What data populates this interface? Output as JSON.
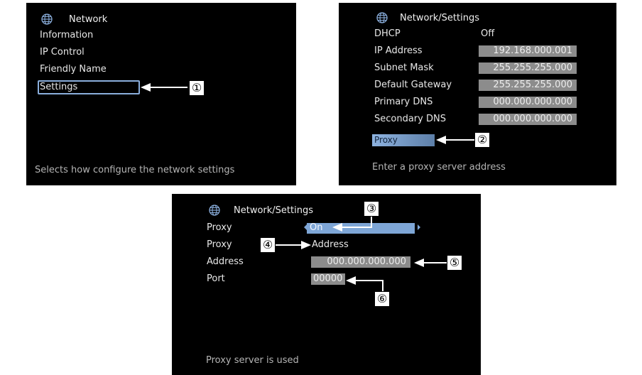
{
  "panel1": {
    "title": "Network",
    "items": [
      "Information",
      "IP Control",
      "Friendly Name",
      "Settings"
    ],
    "footer": "Selects how configure the network settings",
    "callout": "①"
  },
  "panel2": {
    "title": "Network/Settings",
    "dhcp": {
      "label": "DHCP",
      "value": "Off"
    },
    "ip_address": {
      "label": "IP Address",
      "value": "192.168.000.001"
    },
    "subnet_mask": {
      "label": "Subnet Mask",
      "value": "255.255.255.000"
    },
    "default_gateway": {
      "label": "Default Gateway",
      "value": "255.255.255.000"
    },
    "primary_dns": {
      "label": "Primary DNS",
      "value": "000.000.000.000"
    },
    "secondary_dns": {
      "label": "Secondary DNS",
      "value": "000.000.000.000"
    },
    "proxy": {
      "label": "Proxy"
    },
    "footer": "Enter a proxy server address",
    "callout": "②"
  },
  "panel3": {
    "title": "Network/Settings",
    "proxy_on": {
      "label": "Proxy",
      "value": "On"
    },
    "proxy_mode": {
      "label": "Proxy",
      "value": "Address"
    },
    "address": {
      "label": "Address",
      "value": "000.000.000.000"
    },
    "port": {
      "label": "Port",
      "value": "00000"
    },
    "footer": "Proxy server is used",
    "callouts": [
      "③",
      "④",
      "⑤",
      "⑥"
    ]
  },
  "colors": {
    "screen": "#000000",
    "field": "#8c8c8c",
    "highlight": "#8eb3e0"
  }
}
